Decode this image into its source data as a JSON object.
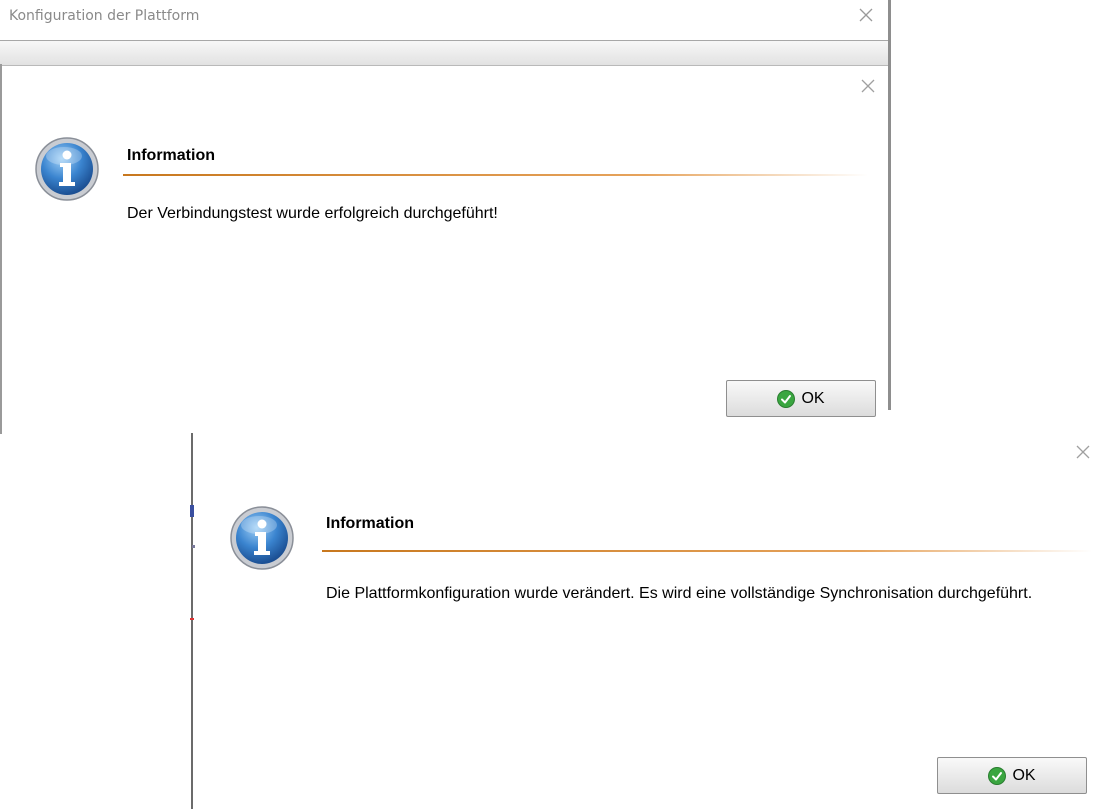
{
  "parent_window": {
    "title": "Konfiguration der Plattform"
  },
  "dialogs": [
    {
      "title": "Information",
      "message": "Der Verbindungstest wurde erfolgreich durchgeführt!",
      "ok_label": "OK"
    },
    {
      "title": "Information",
      "message": "Die Plattformkonfiguration wurde verändert. Es wird eine vollständige Synchronisation durchgeführt.",
      "ok_label": "OK"
    }
  ],
  "colors": {
    "accent_rule": "#c8781e",
    "info_icon_blue": "#2f6fb6",
    "ok_check_green": "#3aa640"
  },
  "icons": [
    "close-icon",
    "info-icon",
    "check-icon"
  ]
}
